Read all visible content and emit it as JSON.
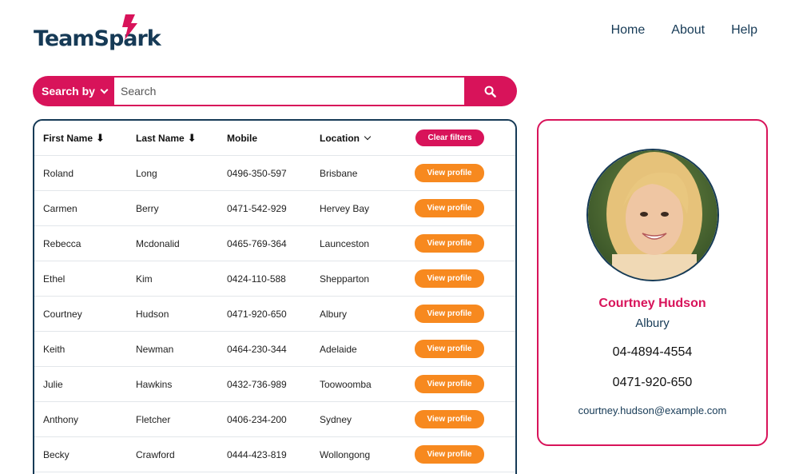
{
  "brand": {
    "logo_text": "TeamSpark",
    "accent": "#d8135a",
    "navy": "#163a56",
    "orange": "#f7891f"
  },
  "nav": {
    "items": [
      "Home",
      "About",
      "Help"
    ]
  },
  "search": {
    "by_label": "Search by",
    "placeholder": "Search",
    "value": ""
  },
  "table": {
    "headers": {
      "first": "First Name",
      "last": "Last Name",
      "mobile": "Mobile",
      "location": "Location",
      "clear": "Clear filters"
    },
    "view_label": "View profile",
    "rows": [
      {
        "first": "Roland",
        "last": "Long",
        "mobile": "0496-350-597",
        "location": "Brisbane"
      },
      {
        "first": "Carmen",
        "last": "Berry",
        "mobile": "0471-542-929",
        "location": "Hervey Bay"
      },
      {
        "first": "Rebecca",
        "last": "Mcdonalid",
        "mobile": "0465-769-364",
        "location": "Launceston"
      },
      {
        "first": "Ethel",
        "last": "Kim",
        "mobile": "0424-110-588",
        "location": "Shepparton"
      },
      {
        "first": "Courtney",
        "last": "Hudson",
        "mobile": "0471-920-650",
        "location": "Albury"
      },
      {
        "first": "Keith",
        "last": "Newman",
        "mobile": "0464-230-344",
        "location": "Adelaide"
      },
      {
        "first": "Julie",
        "last": "Hawkins",
        "mobile": "0432-736-989",
        "location": "Toowoomba"
      },
      {
        "first": "Anthony",
        "last": "Fletcher",
        "mobile": "0406-234-200",
        "location": "Sydney"
      },
      {
        "first": "Becky",
        "last": "Crawford",
        "mobile": "0444-423-819",
        "location": "Wollongong"
      }
    ]
  },
  "profile": {
    "name": "Courtney Hudson",
    "location": "Albury",
    "phone": "04-4894-4554",
    "mobile": "0471-920-650",
    "email": "courtney.hudson@example.com"
  }
}
